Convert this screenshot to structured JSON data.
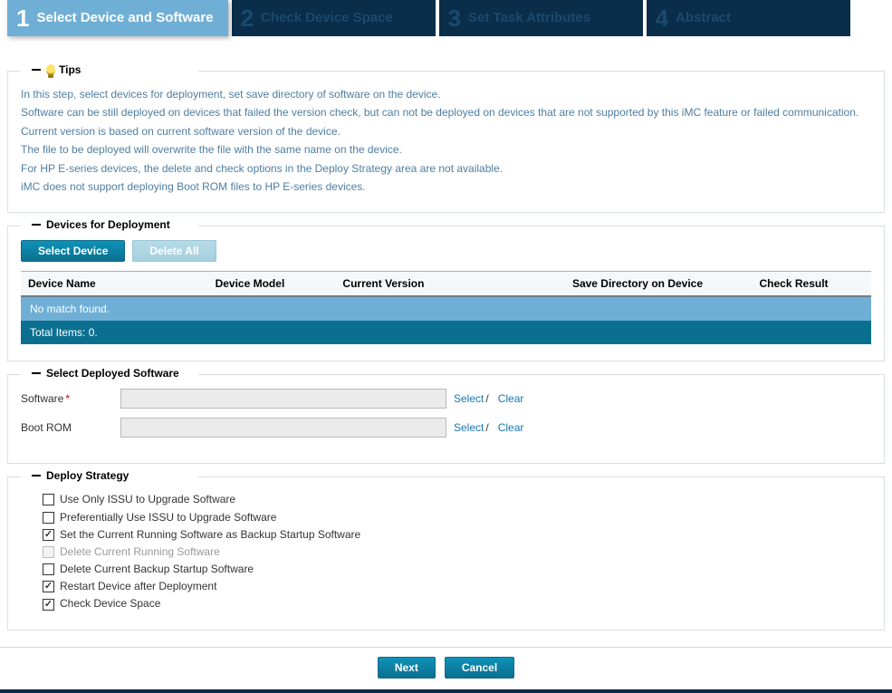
{
  "wizard": {
    "steps": [
      {
        "num": "1",
        "title": "Select Device and Software",
        "active": true
      },
      {
        "num": "2",
        "title": "Check Device Space",
        "active": false
      },
      {
        "num": "3",
        "title": "Set Task Attributes",
        "active": false
      },
      {
        "num": "4",
        "title": "Abstract",
        "active": false
      }
    ]
  },
  "tips": {
    "legend": "Tips",
    "lines": [
      "In this step, select devices for deployment, set save directory of software on the device.",
      "Software can be still deployed on devices that failed the version check, but can not be deployed on devices that are not supported by this iMC feature or failed communication.",
      "Current version is based on current software version of the device.",
      "The file to be deployed will overwrite the file with the same name on the device.",
      "For HP E-series devices, the delete and check options in the Deploy Strategy area are not available.",
      "iMC does not support deploying Boot ROM files to HP E-series devices."
    ]
  },
  "devices": {
    "legend": "Devices for Deployment",
    "select_btn": "Select Device",
    "delete_all_btn": "Delete All",
    "columns": [
      "Device Name",
      "Device Model",
      "Current Version",
      "Save Directory on Device",
      "Check Result"
    ],
    "empty_msg": "No match found.",
    "total_label": "Total Items: 0."
  },
  "software": {
    "legend": "Select Deployed Software",
    "software_label": "Software",
    "bootrom_label": "Boot ROM",
    "software_value": "",
    "bootrom_value": "",
    "select_link": "Select",
    "clear_link": "Clear",
    "slash": "/"
  },
  "strategy": {
    "legend": "Deploy Strategy",
    "options": [
      {
        "label": "Use Only ISSU to Upgrade Software",
        "checked": false,
        "disabled": false
      },
      {
        "label": "Preferentially Use ISSU to Upgrade Software",
        "checked": false,
        "disabled": false
      },
      {
        "label": "Set the Current Running Software as Backup Startup Software",
        "checked": true,
        "disabled": false
      },
      {
        "label": "Delete Current Running Software",
        "checked": false,
        "disabled": true
      },
      {
        "label": "Delete Current Backup Startup Software",
        "checked": false,
        "disabled": false
      },
      {
        "label": "Restart Device after Deployment",
        "checked": true,
        "disabled": false
      },
      {
        "label": "Check Device Space",
        "checked": true,
        "disabled": false
      }
    ]
  },
  "footer": {
    "next": "Next",
    "cancel": "Cancel"
  }
}
